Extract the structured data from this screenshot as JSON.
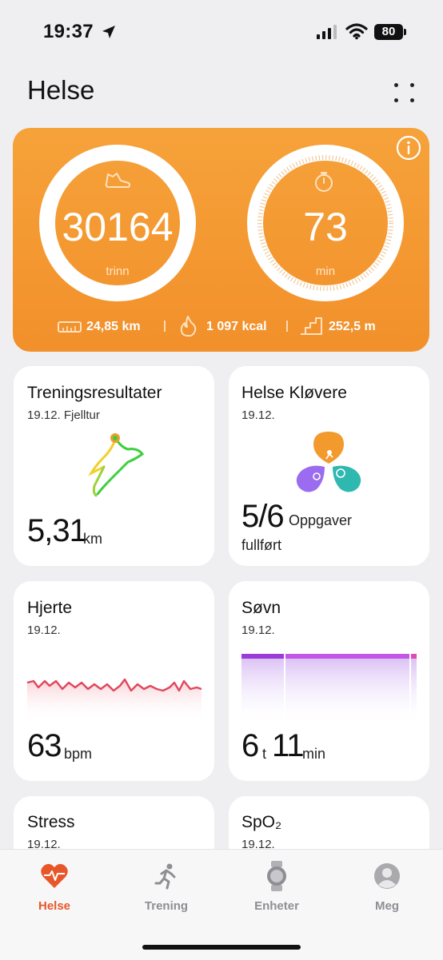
{
  "status_bar": {
    "time": "19:37",
    "battery": "80"
  },
  "header": {
    "title": "Helse"
  },
  "summary": {
    "steps_value": "30164",
    "steps_unit": "trinn",
    "minutes_value": "73",
    "minutes_unit": "min",
    "distance": "24,85 km",
    "calories": "1 097 kcal",
    "elevation": "252,5 m",
    "accent": "#f39a2f"
  },
  "cards": {
    "workout": {
      "title": "Treningsresultater",
      "subtitle": "19.12. Fjelltur",
      "value": "5,31",
      "unit": "km"
    },
    "clover": {
      "title": "Helse Kløvere",
      "date": "19.12.",
      "value": "5/6",
      "unit": "Oppgaver",
      "unit2": "fullført"
    },
    "heart": {
      "title": "Hjerte",
      "date": "19.12.",
      "value": "63",
      "unit": "bpm"
    },
    "sleep": {
      "title": "Søvn",
      "date": "19.12.",
      "hours": "6",
      "hours_unit": "t",
      "minutes": "11",
      "minutes_unit": "min"
    },
    "stress": {
      "title": "Stress",
      "date": "19.12."
    },
    "spo2": {
      "title": "SpO₂",
      "date": "19.12."
    }
  },
  "nav": {
    "items": [
      {
        "label": "Helse",
        "icon": "heart-pulse-icon",
        "active": true
      },
      {
        "label": "Trening",
        "icon": "running-icon",
        "active": false
      },
      {
        "label": "Enheter",
        "icon": "watch-icon",
        "active": false
      },
      {
        "label": "Meg",
        "icon": "profile-icon",
        "active": false
      }
    ]
  },
  "colors": {
    "active_nav": "#e8572a",
    "heart_line": "#e0475c",
    "sleep_bar": "#c356e6",
    "clover_orange": "#f39a2f",
    "clover_purple": "#9b6cf0",
    "clover_teal": "#2fb8b0"
  }
}
